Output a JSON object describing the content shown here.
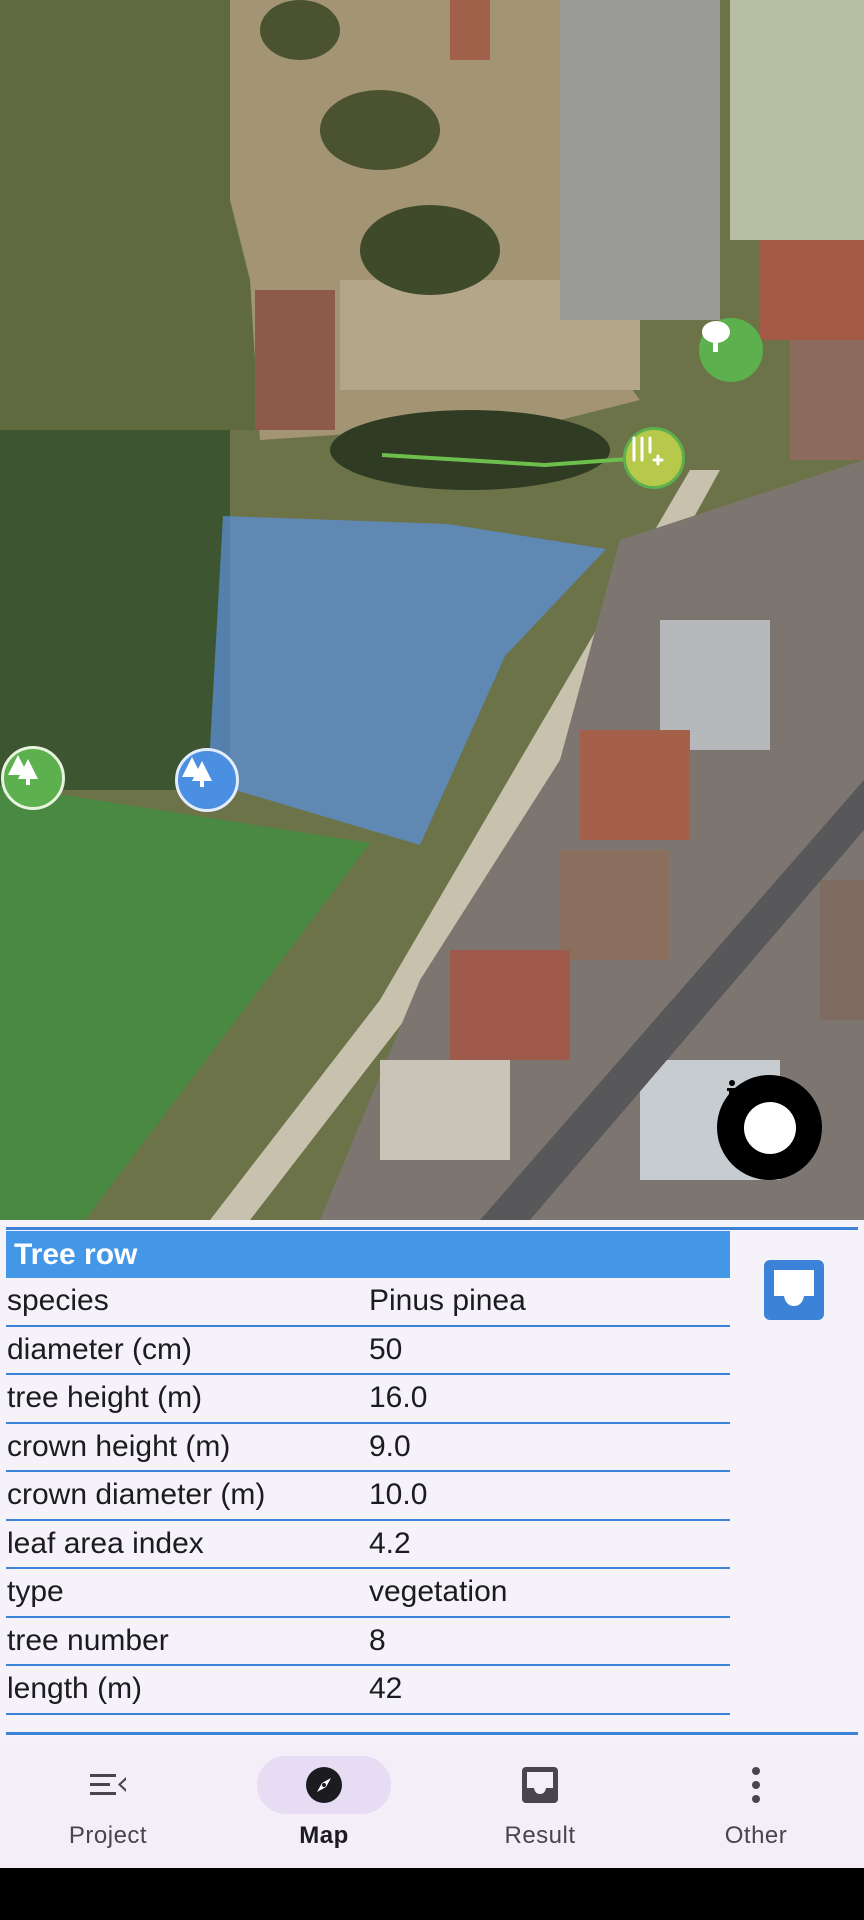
{
  "map": {
    "colors": {
      "polygon_blue": "#5b8fd6",
      "polygon_green": "#3f8f3f",
      "marker_green": "#5cb04d",
      "marker_blue": "#4a8fe2",
      "marker_yellow": "#b6c94a",
      "line_green": "#6cbf4c"
    },
    "markers": [
      "conifer-tree-icon",
      "conifer-tree-icon",
      "deciduous-tree-icon",
      "tree-row-icon"
    ],
    "info_button_icon": "info-icon"
  },
  "panel": {
    "title": "Tree row",
    "rows": [
      {
        "key": "species",
        "value": "Pinus pinea"
      },
      {
        "key": "diameter (cm)",
        "value": "50"
      },
      {
        "key": "tree height (m)",
        "value": "16.0"
      },
      {
        "key": "crown height (m)",
        "value": "9.0"
      },
      {
        "key": "crown diameter (m)",
        "value": "10.0"
      },
      {
        "key": "leaf area index",
        "value": "4.2"
      },
      {
        "key": "type",
        "value": "vegetation"
      },
      {
        "key": "tree number",
        "value": "8"
      },
      {
        "key": "length (m)",
        "value": "42"
      }
    ],
    "accent_color": "#3b82d8",
    "side_button_icon": "inbox-icon"
  },
  "nav": {
    "items": [
      {
        "label": "Project",
        "icon": "menu-open-icon",
        "active": false
      },
      {
        "label": "Map",
        "icon": "compass-icon",
        "active": true
      },
      {
        "label": "Result",
        "icon": "inbox-icon",
        "active": false
      },
      {
        "label": "Other",
        "icon": "more-vertical-icon",
        "active": false
      }
    ]
  }
}
